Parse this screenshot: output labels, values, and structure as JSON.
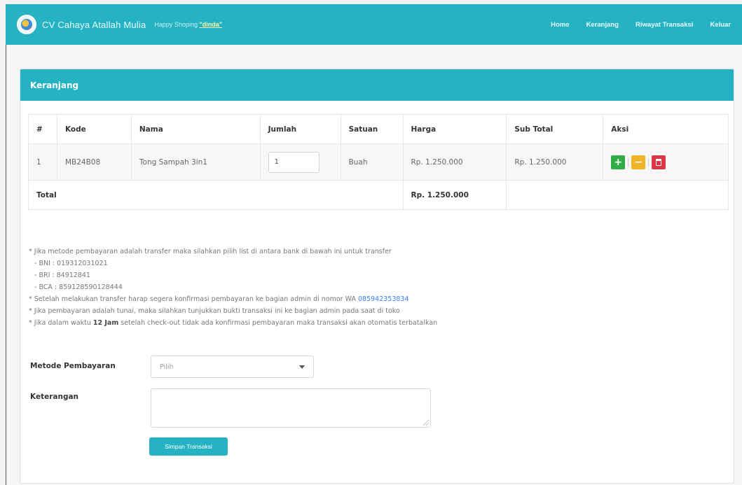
{
  "header": {
    "brand": "CV Cahaya Atallah Mulia",
    "greeting_prefix": "Happy Shoping",
    "username": "\"dinda\"",
    "nav": [
      "Home",
      "Keranjang",
      "Riwayat Transaksi",
      "Keluar"
    ]
  },
  "panel": {
    "title": "Keranjang"
  },
  "table": {
    "headers": [
      "#",
      "Kode",
      "Nama",
      "Jumlah",
      "Satuan",
      "Harga",
      "Sub Total",
      "Aksi"
    ],
    "rows": [
      {
        "no": "1",
        "kode": "MB24B08",
        "nama": "Tong Sampah 3in1",
        "jumlah": "1",
        "satuan": "Buah",
        "harga": "Rp. 1.250.000",
        "subtotal": "Rp. 1.250.000"
      }
    ],
    "total_label": "Total",
    "total_value": "Rp. 1.250.000"
  },
  "notes": {
    "line1": "* Jika metode pembayaran adalah transfer maka silahkan pilih list di antara bank di bawah ini untuk transfer",
    "bank1": "- BNI : 019312031021",
    "bank2": "- BRI : 84912841",
    "bank3": "- BCA : 859128590128444",
    "line2": "* Setelah melakukan transfer harap segera konfirmasi pembayaran ke bagian admin di nomor WA ",
    "wa_number": "085942353834",
    "line3": "* Jika pembayaran adalah tunai, maka silahkan tunjukkan bukti transaksi ini ke bagian admin pada saat di toko",
    "line4_prefix": "* Jika dalam waktu ",
    "line4_bold": "12 Jam",
    "line4_suffix": " setelah check-out tidak ada konfirmasi pembayaran maka transaksi akan otomatis terbatalkan"
  },
  "form": {
    "payment_label": "Metode Pembayaran",
    "payment_placeholder": "Pilih",
    "note_label": "Keterangan",
    "save_label": "Simpan Transaksi"
  },
  "icons": {
    "plus": "+",
    "minus": "−"
  }
}
